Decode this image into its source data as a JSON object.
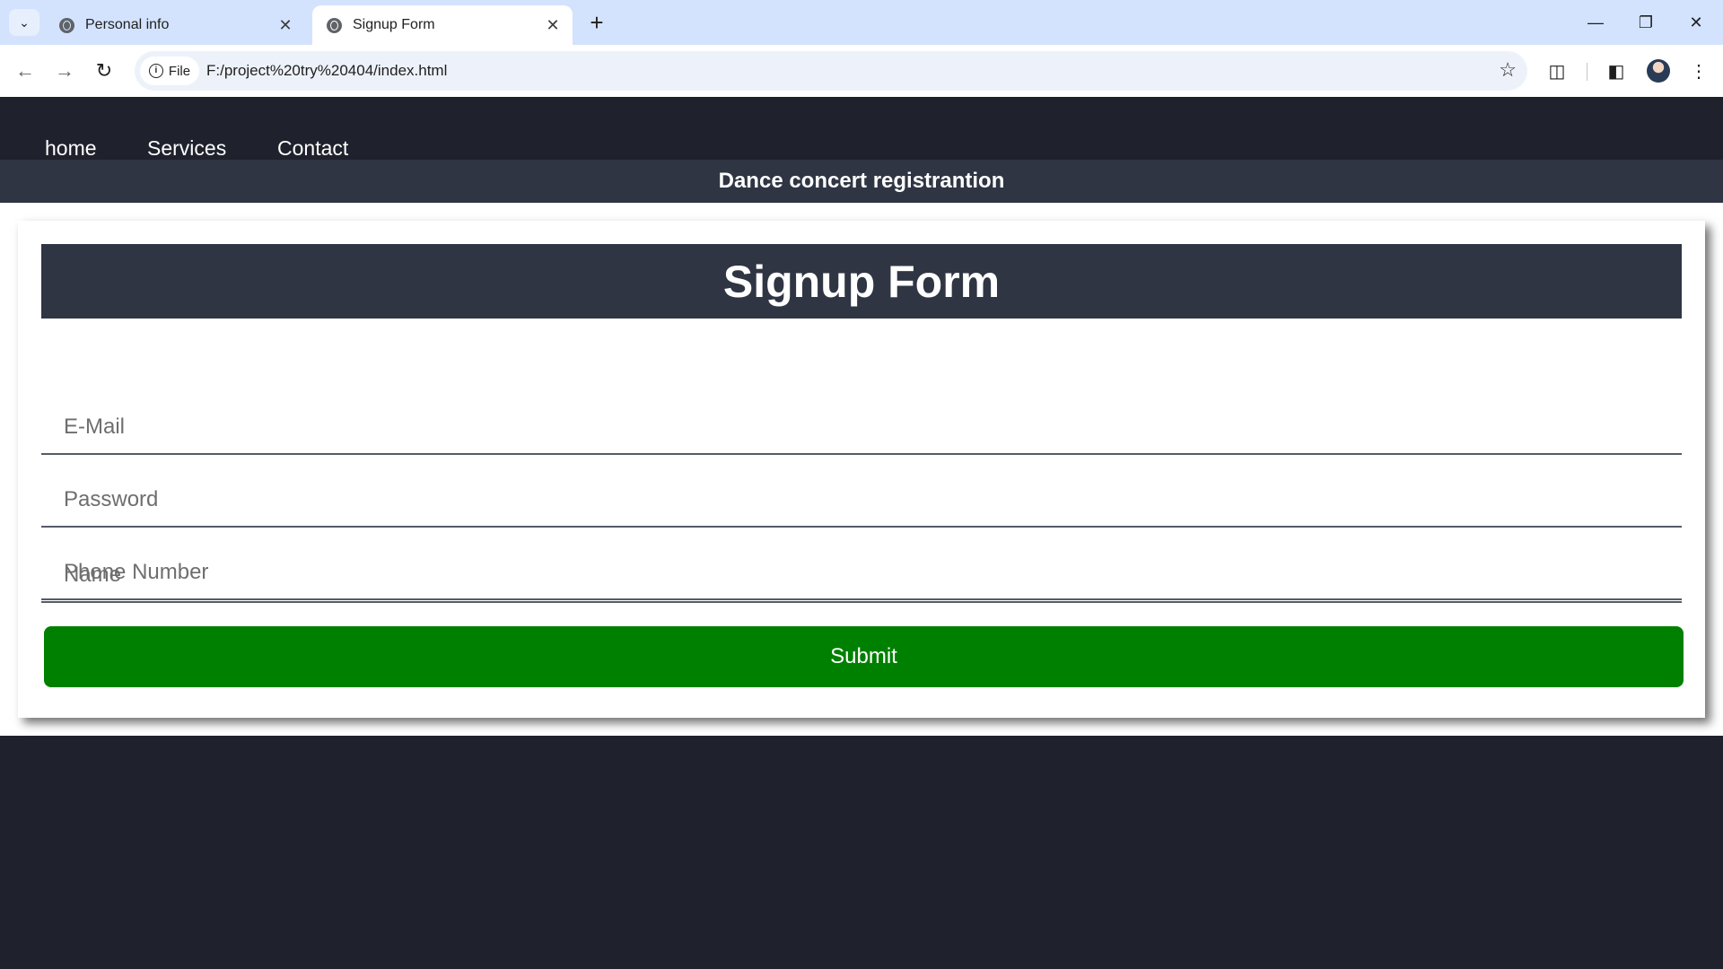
{
  "browser": {
    "tabs": [
      {
        "title": "Personal info",
        "active": false
      },
      {
        "title": "Signup Form",
        "active": true
      }
    ],
    "new_tab_icon": "plus-icon",
    "window_controls": [
      "minimize-icon",
      "restore-icon",
      "close-icon"
    ],
    "address": {
      "chip_label": "File",
      "url": "F:/project%20try%20404/index.html"
    },
    "toolbar_icons": [
      "back-icon",
      "forward-icon",
      "reload-icon",
      "star-icon",
      "extensions-icon",
      "side-panel-icon",
      "avatar",
      "menu-icon"
    ]
  },
  "nav": {
    "links": [
      "home",
      "Services",
      "Contact"
    ]
  },
  "banner": {
    "title": "Dance concert registrantion"
  },
  "form": {
    "title": "Signup Form",
    "fields": [
      {
        "placeholder": "Name",
        "value": ""
      },
      {
        "placeholder": "E-Mail",
        "value": ""
      },
      {
        "placeholder": "Password",
        "value": ""
      },
      {
        "placeholder": "Phone Number",
        "value": ""
      }
    ],
    "submit_label": "Submit"
  },
  "colors": {
    "page_bg": "#1f222c",
    "header_bar": "#2f3543",
    "submit_green": "#008000",
    "tabstrip": "#d3e3fd"
  }
}
